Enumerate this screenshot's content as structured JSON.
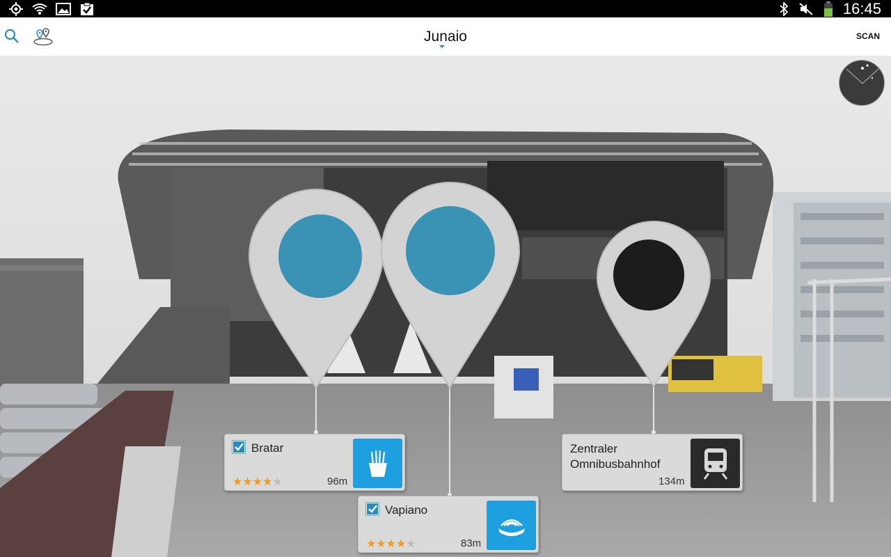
{
  "status_bar": {
    "clock": "16:45",
    "left_icons": [
      "gps-icon",
      "wifi-icon",
      "gallery-icon",
      "clipboard-check-icon"
    ],
    "right_icons": [
      "bluetooth-icon",
      "mute-icon",
      "battery-icon"
    ]
  },
  "action_bar": {
    "title": "Junaio",
    "scan_label": "SCAN",
    "icons": [
      "search-icon",
      "map-pins-icon"
    ]
  },
  "pois": [
    {
      "name": "Bratar",
      "rating": 4,
      "max_rating": 5,
      "distance": "96m",
      "category_icon": "fries-icon",
      "tile_color": "#1e9fe0",
      "pin_color": "#3a92b4",
      "checked": true
    },
    {
      "name": "Vapiano",
      "rating": 4,
      "max_rating": 5,
      "distance": "83m",
      "category_icon": "pasta-icon",
      "tile_color": "#1e9fe0",
      "pin_color": "#3a92b4",
      "checked": true
    },
    {
      "name": "Zentraler Omnibusbahnhof",
      "name_line1": "Zentraler",
      "name_line2": "Omnibusbahnhof",
      "distance": "134m",
      "category_icon": "train-icon",
      "tile_color": "#2a2a2a",
      "pin_color": "#1c1c1c"
    }
  ]
}
